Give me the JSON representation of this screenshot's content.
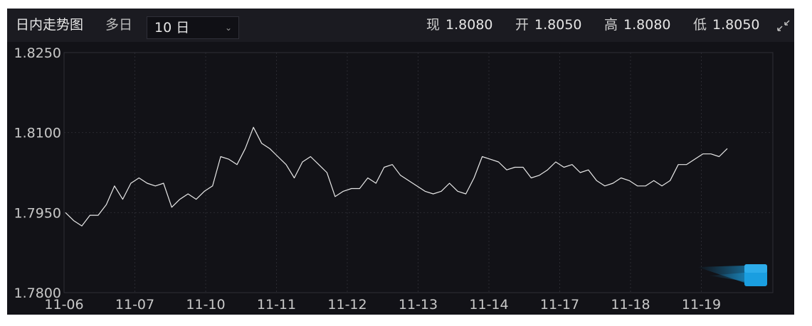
{
  "header": {
    "title": "日内走势图",
    "multi_day_label": "多日",
    "period_select": {
      "value": "10 日",
      "options": [
        "10 日"
      ]
    },
    "quotes": [
      {
        "label": "现",
        "value": "1.8080"
      },
      {
        "label": "开",
        "value": "1.8050"
      },
      {
        "label": "高",
        "value": "1.8080"
      },
      {
        "label": "低",
        "value": "1.8050"
      }
    ]
  },
  "colors": {
    "background": "#121217",
    "header_background": "#1b1b21",
    "line": "#e8e8e8",
    "grid": "#2a2a31",
    "axis_text": "#c8c8c8",
    "accent": "#1a9ee0"
  },
  "icons": {
    "expand": "expand-arrows-icon",
    "logo": "watermark-logo-icon"
  },
  "chart_data": {
    "type": "line",
    "title": "",
    "xlabel": "",
    "ylabel": "",
    "ylim": [
      1.78,
      1.825
    ],
    "y_ticks": [
      "1.8250",
      "1.8100",
      "1.7950",
      "1.7800"
    ],
    "categories": [
      "11-06",
      "11-07",
      "11-10",
      "11-11",
      "11-12",
      "11-13",
      "11-14",
      "11-17",
      "11-18",
      "11-19"
    ],
    "grid": true,
    "series": [
      {
        "values": [
          1.795,
          1.7935,
          1.7925,
          1.7945,
          1.7945,
          1.7965,
          1.8,
          1.7975,
          1.8005,
          1.8015,
          1.8005,
          1.8,
          1.8005,
          1.796,
          1.7975,
          1.7985,
          1.7975,
          1.799,
          1.8,
          1.8055,
          1.805,
          1.804,
          1.807,
          1.811,
          1.808,
          1.807,
          1.8055,
          1.804,
          1.8015,
          1.8045,
          1.8055,
          1.804,
          1.8025,
          1.798,
          1.799,
          1.7995,
          1.7995,
          1.8015,
          1.8005,
          1.8035,
          1.804,
          1.802,
          1.801,
          1.8,
          1.799,
          1.7985,
          1.799,
          1.8005,
          1.799,
          1.7985,
          1.8015,
          1.8055,
          1.805,
          1.8045,
          1.803,
          1.8035,
          1.8035,
          1.8015,
          1.802,
          1.803,
          1.8045,
          1.8035,
          1.804,
          1.8025,
          1.803,
          1.801,
          1.8,
          1.8005,
          1.8015,
          1.801,
          1.8,
          1.8,
          1.801,
          1.8,
          1.801,
          1.804,
          1.804,
          1.805,
          1.806,
          1.806,
          1.8055,
          1.807
        ]
      }
    ]
  }
}
